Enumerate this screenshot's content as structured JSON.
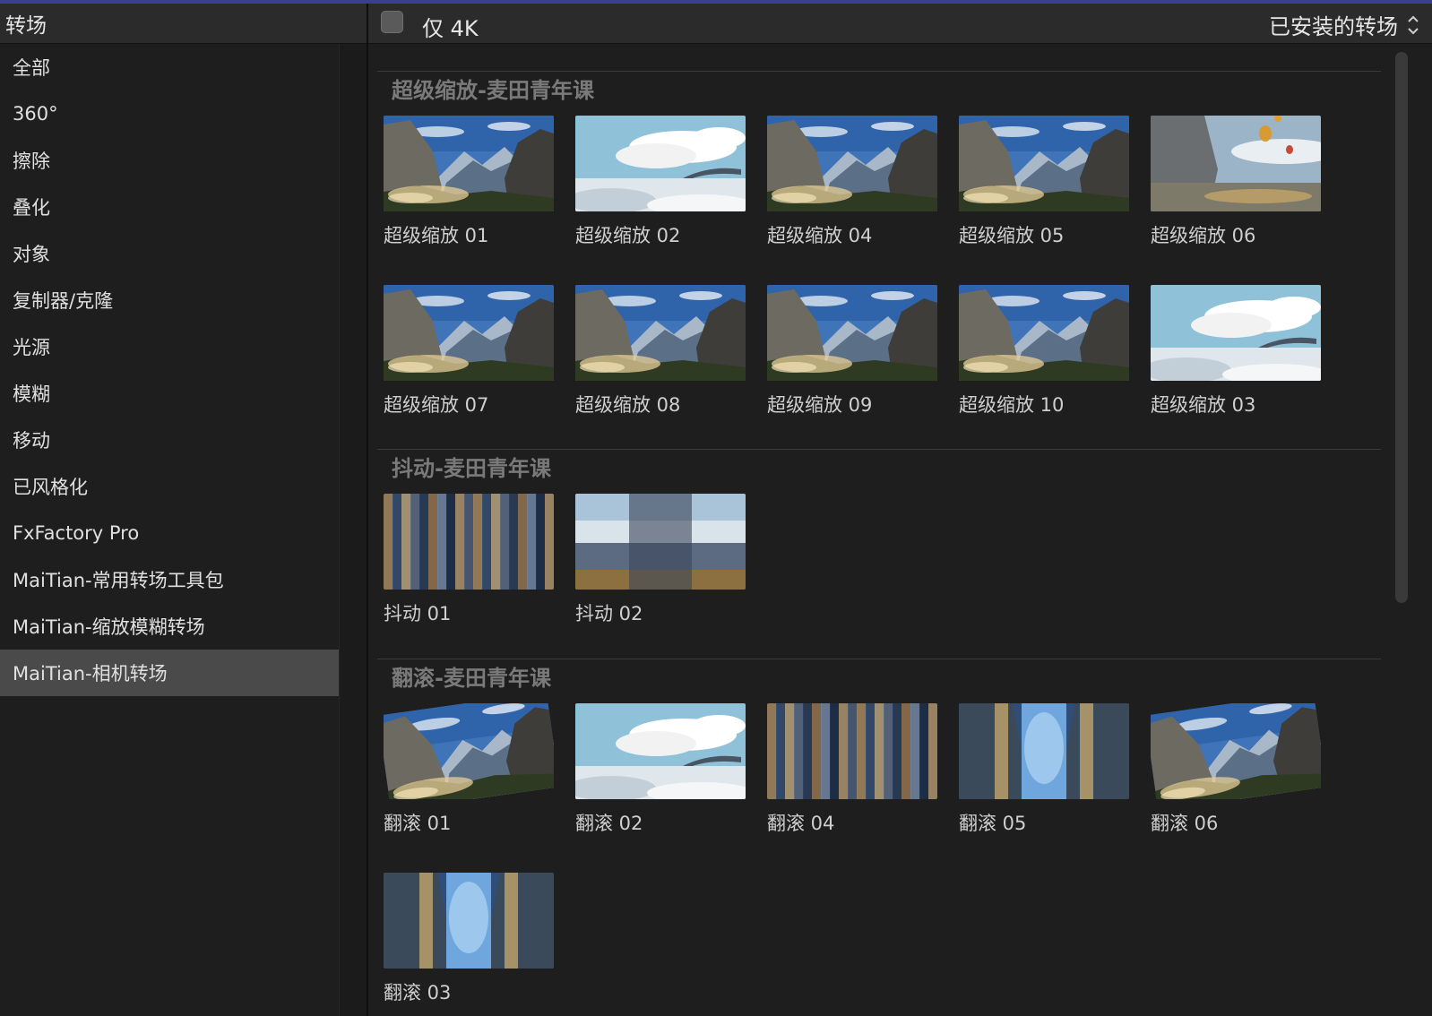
{
  "sidebar": {
    "title": "转场",
    "items": [
      {
        "label": "全部"
      },
      {
        "label": "360°"
      },
      {
        "label": "擦除"
      },
      {
        "label": "叠化"
      },
      {
        "label": "对象"
      },
      {
        "label": "复制器/克隆"
      },
      {
        "label": "光源"
      },
      {
        "label": "模糊"
      },
      {
        "label": "移动"
      },
      {
        "label": "已风格化"
      },
      {
        "label": "FxFactory Pro"
      },
      {
        "label": "MaiTian-常用转场工具包"
      },
      {
        "label": "MaiTian-缩放模糊转场"
      },
      {
        "label": "MaiTian-相机转场",
        "selected": true
      }
    ]
  },
  "header": {
    "k4_label": "仅 4K",
    "installed_label": "已安装的转场"
  },
  "sections": [
    {
      "title": "超级缩放-麦田青年课",
      "tiles": [
        {
          "label": "超级缩放 01",
          "scene": "valley"
        },
        {
          "label": "超级缩放 02",
          "scene": "clouds"
        },
        {
          "label": "超级缩放 04",
          "scene": "valley"
        },
        {
          "label": "超级缩放 05",
          "scene": "valley"
        },
        {
          "label": "超级缩放 06",
          "scene": "balloons"
        },
        {
          "label": "超级缩放 07",
          "scene": "valley"
        },
        {
          "label": "超级缩放 08",
          "scene": "valley"
        },
        {
          "label": "超级缩放 09",
          "scene": "valley"
        },
        {
          "label": "超级缩放 10",
          "scene": "valley"
        },
        {
          "label": "超级缩放 03",
          "scene": "clouds"
        }
      ]
    },
    {
      "title": "抖动-麦田青年课",
      "tiles": [
        {
          "label": "抖动 01",
          "scene": "blur-v"
        },
        {
          "label": "抖动 02",
          "scene": "blur-h"
        }
      ]
    },
    {
      "title": "翻滚-麦田青年课",
      "tiles": [
        {
          "label": "翻滚 01",
          "scene": "valley-tilt"
        },
        {
          "label": "翻滚 02",
          "scene": "clouds"
        },
        {
          "label": "翻滚 04",
          "scene": "blur-v"
        },
        {
          "label": "翻滚 05",
          "scene": "mirror"
        },
        {
          "label": "翻滚 06",
          "scene": "valley-tilt"
        },
        {
          "label": "翻滚 03",
          "scene": "mirror"
        }
      ]
    }
  ],
  "colors": {
    "selected_item": "#4a4a4a",
    "header_bg": "#2b2b2b",
    "background": "#1e1e1e",
    "section_title": "#7a7a7a",
    "accent_line": "#3b3f8f"
  },
  "icons": {
    "sort": "chevron-updown-icon",
    "checkbox": "checkbox-icon"
  }
}
